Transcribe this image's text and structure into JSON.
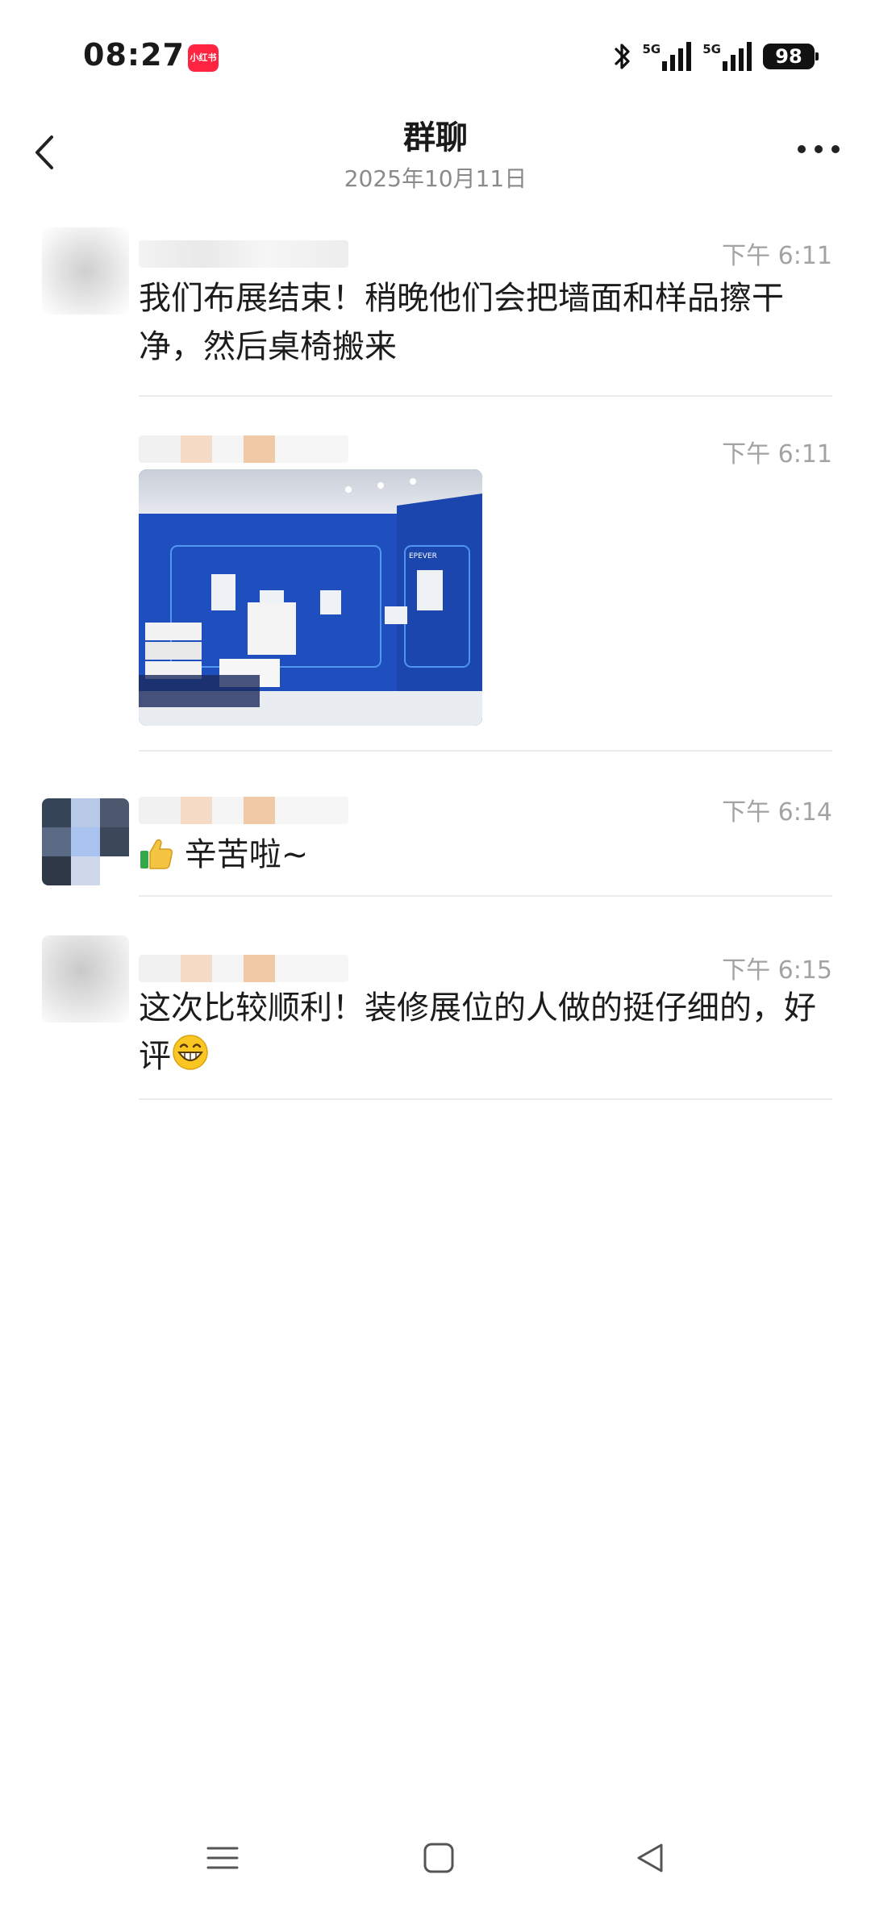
{
  "status_bar": {
    "time": "08:27",
    "app_badge": "小红书",
    "network_1": "5G",
    "network_2": "5G",
    "battery": "98",
    "icons": [
      "bluetooth-icon",
      "signal-icon",
      "signal-icon"
    ]
  },
  "header": {
    "title": "群聊",
    "subtitle": "2025年10月11日",
    "back_icon": "chevron-left-icon",
    "more_icon": "more-dots-icon"
  },
  "messages": [
    {
      "time": "下午 6:11",
      "text": "我们布展结束！稍晚他们会把墙面和样品擦干净，然后桌椅搬来"
    },
    {
      "time": "下午 6:11",
      "type": "image",
      "image_text": "EPEVER",
      "image_icon": "exhibition-booth-photo"
    },
    {
      "time": "下午 6:14",
      "emoji": "thumbs-up-icon",
      "text": "辛苦啦~"
    },
    {
      "time": "下午 6:15",
      "text": "这次比较顺利！装修展位的人做的挺仔细的，好评",
      "emoji": "grin-icon"
    }
  ],
  "nav_bar": {
    "icons": [
      "menu-icon",
      "home-square-icon",
      "back-triangle-icon"
    ]
  },
  "colors": {
    "time_gray": "#a3a3a3",
    "booth_blue": "#1f4fbf",
    "badge_red": "#ff2442"
  }
}
